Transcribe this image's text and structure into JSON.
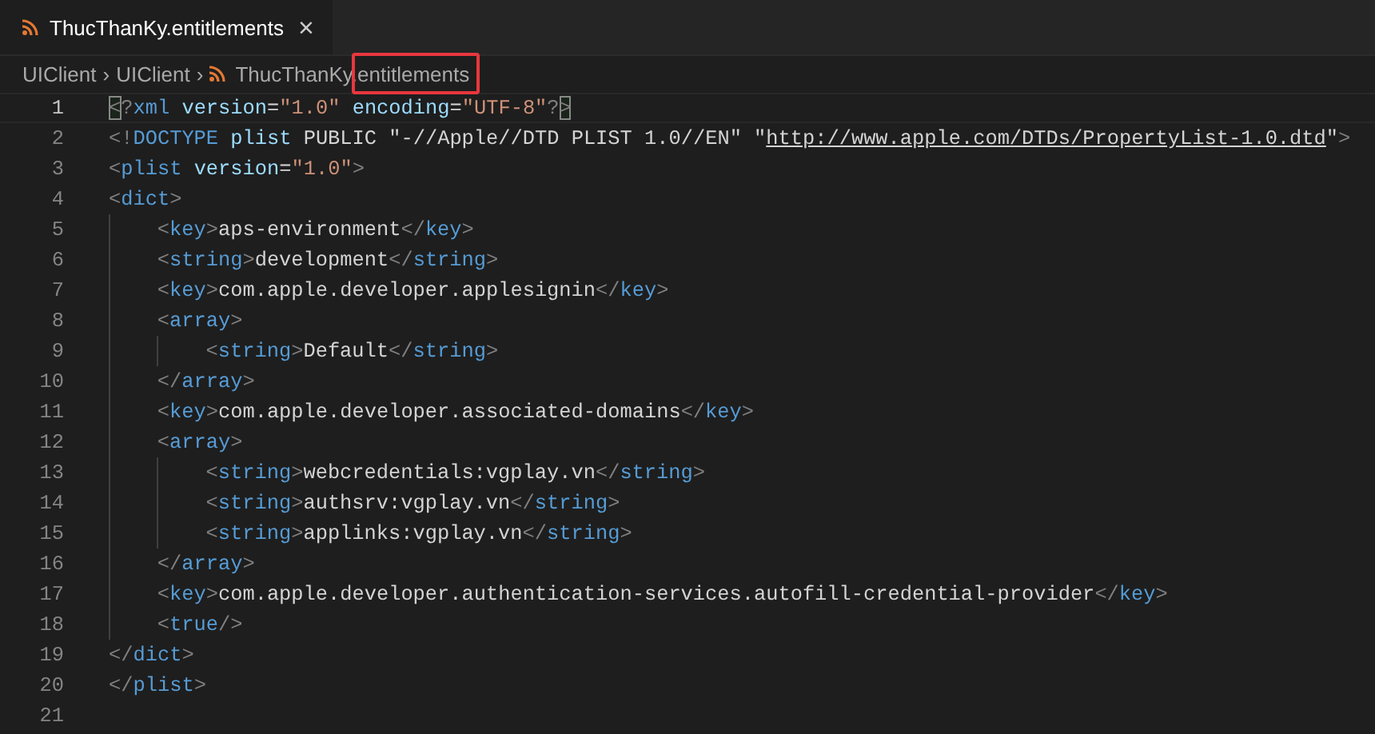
{
  "tabs": [
    {
      "label": "ThucThanKy.entitlements",
      "selected": true,
      "close": "×"
    }
  ],
  "breadcrumb": {
    "items": [
      "UIClient",
      "UIClient"
    ],
    "file": "ThucThanKy.entitlements",
    "separator": "›"
  },
  "editor": {
    "lines": [
      {
        "number": "1",
        "active": true,
        "tokens": [
          {
            "kind": "punct",
            "text": "<",
            "matched": true
          },
          {
            "kind": "punct",
            "text": "?"
          },
          {
            "kind": "tag",
            "text": "xml"
          },
          {
            "kind": "attr",
            "text": " version"
          },
          {
            "kind": "text",
            "text": "="
          },
          {
            "kind": "value",
            "text": "\"1.0\""
          },
          {
            "kind": "attr",
            "text": " encoding"
          },
          {
            "kind": "text",
            "text": "="
          },
          {
            "kind": "value",
            "text": "\"UTF-8\""
          },
          {
            "kind": "punct",
            "text": "?"
          },
          {
            "kind": "punct",
            "text": ">",
            "matched": true
          }
        ]
      },
      {
        "number": "2",
        "active": false,
        "tokens": [
          {
            "kind": "punct",
            "text": "<!"
          },
          {
            "kind": "tag",
            "text": "DOCTYPE"
          },
          {
            "kind": "attr",
            "text": " plist"
          },
          {
            "kind": "text",
            "text": " PUBLIC \"-//Apple//DTD PLIST 1.0//EN\" \""
          },
          {
            "kind": "link",
            "text": "http://www.apple.com/DTDs/PropertyList-1.0.dtd"
          },
          {
            "kind": "text",
            "text": "\""
          },
          {
            "kind": "punct",
            "text": ">"
          }
        ]
      },
      {
        "number": "3",
        "active": false,
        "tokens": [
          {
            "kind": "punct",
            "text": "<"
          },
          {
            "kind": "tag",
            "text": "plist"
          },
          {
            "kind": "attr",
            "text": " version"
          },
          {
            "kind": "text",
            "text": "="
          },
          {
            "kind": "value",
            "text": "\"1.0\""
          },
          {
            "kind": "punct",
            "text": ">"
          }
        ]
      },
      {
        "number": "4",
        "active": false,
        "tokens": [
          {
            "kind": "punct",
            "text": "<"
          },
          {
            "kind": "tag",
            "text": "dict"
          },
          {
            "kind": "punct",
            "text": ">"
          }
        ]
      },
      {
        "children": [
          {
            "number": "5",
            "active": false,
            "tokens": [
              {
                "kind": "punct",
                "text": "<"
              },
              {
                "kind": "tag",
                "text": "key"
              },
              {
                "kind": "punct",
                "text": ">"
              },
              {
                "kind": "text",
                "text": "aps-environment"
              },
              {
                "kind": "punct",
                "text": "</"
              },
              {
                "kind": "tag",
                "text": "key"
              },
              {
                "kind": "punct",
                "text": ">"
              }
            ]
          },
          {
            "number": "6",
            "active": false,
            "tokens": [
              {
                "kind": "punct",
                "text": "<"
              },
              {
                "kind": "tag",
                "text": "string"
              },
              {
                "kind": "punct",
                "text": ">"
              },
              {
                "kind": "text",
                "text": "development"
              },
              {
                "kind": "punct",
                "text": "</"
              },
              {
                "kind": "tag",
                "text": "string"
              },
              {
                "kind": "punct",
                "text": ">"
              }
            ]
          },
          {
            "number": "7",
            "active": false,
            "tokens": [
              {
                "kind": "punct",
                "text": "<"
              },
              {
                "kind": "tag",
                "text": "key"
              },
              {
                "kind": "punct",
                "text": ">"
              },
              {
                "kind": "text",
                "text": "com.apple.developer.applesignin"
              },
              {
                "kind": "punct",
                "text": "</"
              },
              {
                "kind": "tag",
                "text": "key"
              },
              {
                "kind": "punct",
                "text": ">"
              }
            ]
          },
          {
            "number": "8",
            "active": false,
            "tokens": [
              {
                "kind": "punct",
                "text": "<"
              },
              {
                "kind": "tag",
                "text": "array"
              },
              {
                "kind": "punct",
                "text": ">"
              }
            ]
          },
          {
            "children": [
              {
                "number": "9",
                "active": false,
                "tokens": [
                  {
                    "kind": "punct",
                    "text": "<"
                  },
                  {
                    "kind": "tag",
                    "text": "string"
                  },
                  {
                    "kind": "punct",
                    "text": ">"
                  },
                  {
                    "kind": "text",
                    "text": "Default"
                  },
                  {
                    "kind": "punct",
                    "text": "</"
                  },
                  {
                    "kind": "tag",
                    "text": "string"
                  },
                  {
                    "kind": "punct",
                    "text": ">"
                  }
                ]
              }
            ]
          },
          {
            "number": "10",
            "active": false,
            "tokens": [
              {
                "kind": "punct",
                "text": "</"
              },
              {
                "kind": "tag",
                "text": "array"
              },
              {
                "kind": "punct",
                "text": ">"
              }
            ]
          },
          {
            "number": "11",
            "active": false,
            "tokens": [
              {
                "kind": "punct",
                "text": "<"
              },
              {
                "kind": "tag",
                "text": "key"
              },
              {
                "kind": "punct",
                "text": ">"
              },
              {
                "kind": "text",
                "text": "com.apple.developer.associated-domains"
              },
              {
                "kind": "punct",
                "text": "</"
              },
              {
                "kind": "tag",
                "text": "key"
              },
              {
                "kind": "punct",
                "text": ">"
              }
            ]
          },
          {
            "number": "12",
            "active": false,
            "tokens": [
              {
                "kind": "punct",
                "text": "<"
              },
              {
                "kind": "tag",
                "text": "array"
              },
              {
                "kind": "punct",
                "text": ">"
              }
            ]
          },
          {
            "children": [
              {
                "number": "13",
                "active": false,
                "tokens": [
                  {
                    "kind": "punct",
                    "text": "<"
                  },
                  {
                    "kind": "tag",
                    "text": "string"
                  },
                  {
                    "kind": "punct",
                    "text": ">"
                  },
                  {
                    "kind": "text",
                    "text": "webcredentials:vgplay.vn"
                  },
                  {
                    "kind": "punct",
                    "text": "</"
                  },
                  {
                    "kind": "tag",
                    "text": "string"
                  },
                  {
                    "kind": "punct",
                    "text": ">"
                  }
                ]
              },
              {
                "number": "14",
                "active": false,
                "tokens": [
                  {
                    "kind": "punct",
                    "text": "<"
                  },
                  {
                    "kind": "tag",
                    "text": "string"
                  },
                  {
                    "kind": "punct",
                    "text": ">"
                  },
                  {
                    "kind": "text",
                    "text": "authsrv:vgplay.vn"
                  },
                  {
                    "kind": "punct",
                    "text": "</"
                  },
                  {
                    "kind": "tag",
                    "text": "string"
                  },
                  {
                    "kind": "punct",
                    "text": ">"
                  }
                ]
              },
              {
                "number": "15",
                "active": false,
                "tokens": [
                  {
                    "kind": "punct",
                    "text": "<"
                  },
                  {
                    "kind": "tag",
                    "text": "string"
                  },
                  {
                    "kind": "punct",
                    "text": ">"
                  },
                  {
                    "kind": "text",
                    "text": "applinks:vgplay.vn"
                  },
                  {
                    "kind": "punct",
                    "text": "</"
                  },
                  {
                    "kind": "tag",
                    "text": "string"
                  },
                  {
                    "kind": "punct",
                    "text": ">"
                  }
                ]
              }
            ]
          },
          {
            "number": "16",
            "active": false,
            "tokens": [
              {
                "kind": "punct",
                "text": "</"
              },
              {
                "kind": "tag",
                "text": "array"
              },
              {
                "kind": "punct",
                "text": ">"
              }
            ]
          },
          {
            "number": "17",
            "active": false,
            "tokens": [
              {
                "kind": "punct",
                "text": "<"
              },
              {
                "kind": "tag",
                "text": "key"
              },
              {
                "kind": "punct",
                "text": ">"
              },
              {
                "kind": "text",
                "text": "com.apple.developer.authentication-services.autofill-credential-provider"
              },
              {
                "kind": "punct",
                "text": "</"
              },
              {
                "kind": "tag",
                "text": "key"
              },
              {
                "kind": "punct",
                "text": ">"
              }
            ]
          },
          {
            "number": "18",
            "active": false,
            "tokens": [
              {
                "kind": "punct",
                "text": "<"
              },
              {
                "kind": "tag",
                "text": "true"
              },
              {
                "kind": "punct",
                "text": "/>"
              }
            ]
          }
        ]
      },
      {
        "number": "19",
        "active": false,
        "tokens": [
          {
            "kind": "punct",
            "text": "</"
          },
          {
            "kind": "tag",
            "text": "dict"
          },
          {
            "kind": "punct",
            "text": ">"
          }
        ]
      },
      {
        "number": "20",
        "active": false,
        "tokens": [
          {
            "kind": "punct",
            "text": "</"
          },
          {
            "kind": "tag",
            "text": "plist"
          },
          {
            "kind": "punct",
            "text": ">"
          }
        ]
      },
      {
        "number": "21",
        "active": false
      }
    ]
  }
}
